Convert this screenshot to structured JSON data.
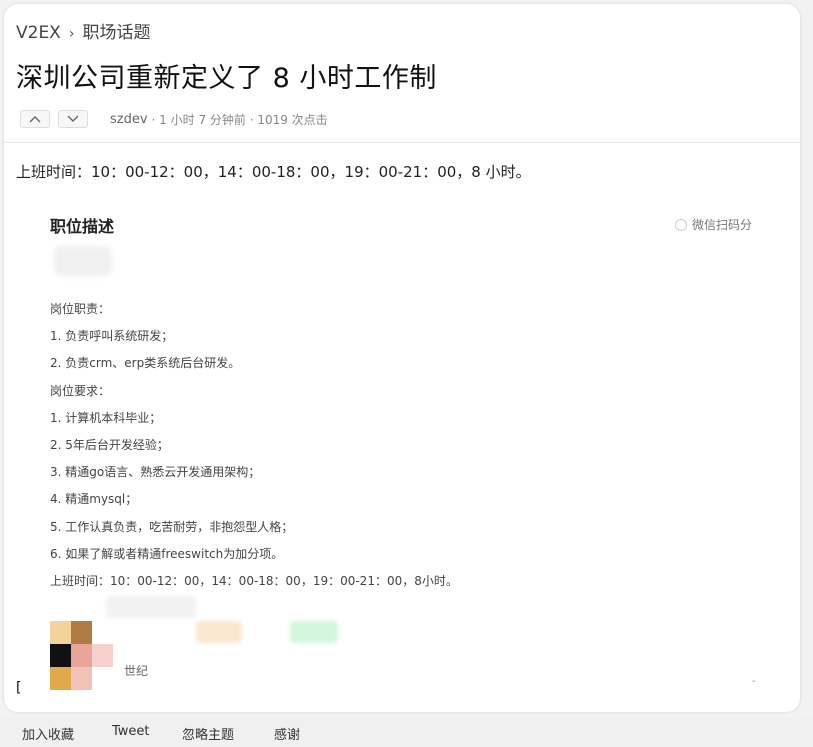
{
  "breadcrumb": {
    "site": "V2EX",
    "sep": "›",
    "node": "职场话题"
  },
  "topic": {
    "title": "深圳公司重新定义了 8 小时工作制",
    "author": "szdev",
    "meta": "· 1 小时 7 分钟前 · 1019 次点击",
    "content": "上班时间：10：00-12：00，14：00-18：00，19：00-21：00，8 小时。"
  },
  "job_image": {
    "heading": "职位描述",
    "wechat": "微信扫码分",
    "lines": [
      "岗位职责：",
      "1. 负责呼叫系统研发；",
      "2. 负责crm、erp类系统后台研发。",
      "岗位要求：",
      "1. 计算机本科毕业；",
      "2. 5年后台开发经验；",
      "3. 精通go语言、熟悉云开发通用架构；",
      "4. 精通mysql；",
      "5. 工作认真负责，吃苦耐劳，非抱怨型人格；",
      "6. 如果了解或者精通freeswitch为加分项。",
      "上班时间：10：00-12：00，14：00-18：00，19：00-21：00，8小时。"
    ],
    "signature": "世纪"
  },
  "footer": {
    "favorite": "加入收藏",
    "tweet": "Tweet",
    "ignore": "忽略主题",
    "thanks": "感谢"
  },
  "colors": {
    "background": "#f2f2f2",
    "card": "#ffffff",
    "muted": "#888888"
  }
}
